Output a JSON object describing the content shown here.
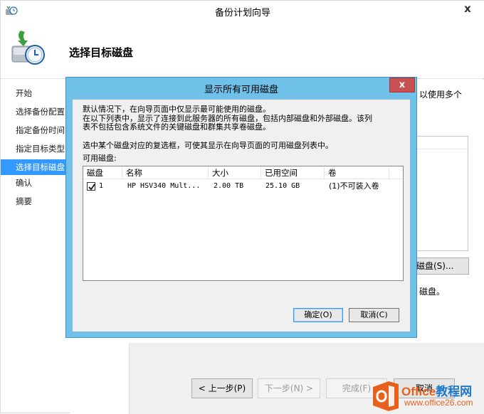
{
  "window": {
    "title": "备份计划向导",
    "close_label": "x"
  },
  "header": {
    "heading": "选择目标磁盘",
    "icon": "backup-wizard-icon"
  },
  "sidebar": {
    "items": [
      {
        "label": "开始",
        "active": false
      },
      {
        "label": "选择备份配置",
        "active": false
      },
      {
        "label": "指定备份时间",
        "active": false
      },
      {
        "label": "指定目标类型",
        "active": false
      },
      {
        "label": "选择目标磁盘",
        "active": true
      },
      {
        "label": "确认",
        "active": false
      },
      {
        "label": "摘要",
        "active": false
      }
    ]
  },
  "background_content": {
    "right_text": "以使用多个",
    "disk_button_label": "磁盘(S)...",
    "disk_text": "磁盘。"
  },
  "nav_buttons": {
    "prev": "< 上一步(P)",
    "next": "下一步(N) >",
    "finish": "完成(F)",
    "cancel": "取消"
  },
  "dialog": {
    "title": "显示所有可用磁盘",
    "close_label": "x",
    "desc_line1": "默认情况下，在向导页面中仅显示最可能使用的磁盘。",
    "desc_line2": "在以下列表中，显示了连接到此服务器的所有磁盘，包括内部磁盘和外部磁盘。该列",
    "desc_line3": "表不包括包含系统文件的关键磁盘和群集共享卷磁盘。",
    "desc_line4": "选中某个磁盘对应的复选框，可使其显示在向导页面的可用磁盘列表中。",
    "list_label": "可用磁盘:",
    "columns": [
      "磁盘",
      "名称",
      "大小",
      "已用空间",
      "卷"
    ],
    "rows": [
      {
        "checked": true,
        "disk": "1",
        "name": "HP HSV340  Mult...",
        "size": "2.00 TB",
        "used": "25.10 GB",
        "volume": "(1)不可装入卷"
      }
    ],
    "ok_label": "确定(O)",
    "cancel_label": "取消(C)"
  },
  "watermark": {
    "line1_part1": "Office",
    "line1_part2": "教程网",
    "line2": "www.office26.com"
  },
  "colors": {
    "dialog_frame": "#6fc1e9",
    "selected_item": "#3399ff",
    "close_red": "#c75050",
    "watermark_orange": "#e8611c"
  }
}
